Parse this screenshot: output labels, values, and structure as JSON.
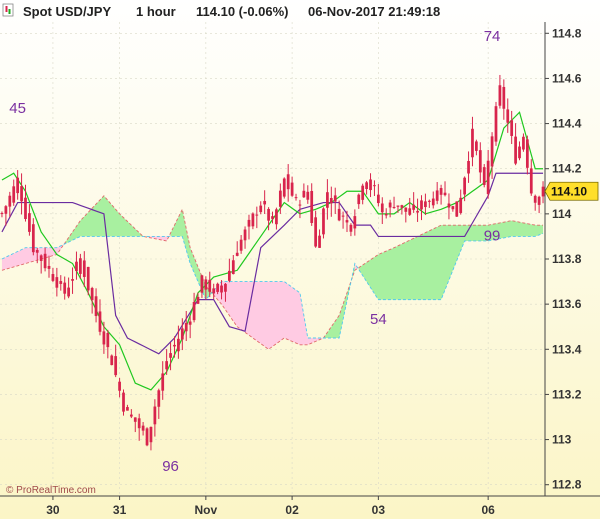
{
  "header": {
    "instrument": "Spot USD/JPY",
    "timeframe": "1 hour",
    "price_change": "114.10 (-0.06%)",
    "datetime": "06-Nov-2017 21:49:18"
  },
  "watermark": "© ProRealTime.com",
  "colors": {
    "bg_top": "#ffffff",
    "bg_bottom": "#fbf5c6",
    "up_candle": "#d8244c",
    "down_candle": "#d8244c",
    "kijun": "#6a2ca0",
    "tenkan": "#1fc81f",
    "cloud_bull": "#a8f0a0",
    "cloud_bear": "#ffcbe3",
    "span_b_line": "#4fc8ee",
    "span_a_line": "#e06a6a",
    "last_price_bg": "#ffdf2a"
  },
  "chart_data": {
    "type": "candlestick",
    "title": "Spot USD/JPY 1 hour",
    "ylim": [
      112.75,
      114.85
    ],
    "y_ticks": [
      "112.8",
      "113",
      "113.2",
      "113.4",
      "113.6",
      "113.8",
      "114",
      "114.2",
      "114.4",
      "114.6",
      "114.8"
    ],
    "y_tick_values": [
      112.8,
      113.0,
      113.2,
      113.4,
      113.6,
      113.8,
      114.0,
      114.2,
      114.4,
      114.6,
      114.8
    ],
    "x_ticks": [
      "30",
      "31",
      "Nov",
      "02",
      "03",
      "06"
    ],
    "x_tick_index": [
      13,
      30,
      52,
      74,
      96,
      124
    ],
    "n_bars": 139,
    "close_path": [
      [
        0,
        114.0
      ],
      [
        4,
        114.15
      ],
      [
        8,
        113.85
      ],
      [
        12,
        113.75
      ],
      [
        16,
        113.65
      ],
      [
        20,
        113.8
      ],
      [
        24,
        113.55
      ],
      [
        28,
        113.35
      ],
      [
        31,
        113.15
      ],
      [
        34,
        113.08
      ],
      [
        37,
        113.0
      ],
      [
        39,
        113.15
      ],
      [
        42,
        113.35
      ],
      [
        45,
        113.45
      ],
      [
        48,
        113.55
      ],
      [
        51,
        113.7
      ],
      [
        54,
        113.65
      ],
      [
        57,
        113.7
      ],
      [
        60,
        113.85
      ],
      [
        63,
        113.95
      ],
      [
        66,
        114.05
      ],
      [
        69,
        113.95
      ],
      [
        72,
        114.15
      ],
      [
        75,
        114.05
      ],
      [
        78,
        114.1
      ],
      [
        80,
        113.85
      ],
      [
        83,
        114.1
      ],
      [
        86,
        114.0
      ],
      [
        89,
        113.95
      ],
      [
        92,
        114.15
      ],
      [
        95,
        114.1
      ],
      [
        97,
        114.0
      ],
      [
        100,
        114.05
      ],
      [
        104,
        114.0
      ],
      [
        108,
        114.05
      ],
      [
        112,
        114.1
      ],
      [
        116,
        114.0
      ],
      [
        120,
        114.35
      ],
      [
        123,
        114.1
      ],
      [
        125,
        114.35
      ],
      [
        127,
        114.55
      ],
      [
        129,
        114.4
      ],
      [
        131,
        114.25
      ],
      [
        133,
        114.35
      ],
      [
        135,
        114.1
      ],
      [
        137,
        114.05
      ],
      [
        138,
        114.1
      ]
    ],
    "kijun_path": [
      [
        0,
        113.92
      ],
      [
        4,
        114.05
      ],
      [
        10,
        114.05
      ],
      [
        18,
        114.05
      ],
      [
        26,
        114.0
      ],
      [
        29,
        113.55
      ],
      [
        32,
        113.45
      ],
      [
        40,
        113.38
      ],
      [
        44,
        113.45
      ],
      [
        50,
        113.62
      ],
      [
        54,
        113.62
      ],
      [
        58,
        113.5
      ],
      [
        62,
        113.48
      ],
      [
        66,
        113.85
      ],
      [
        72,
        113.95
      ],
      [
        76,
        114.02
      ],
      [
        82,
        114.05
      ],
      [
        86,
        114.05
      ],
      [
        90,
        113.95
      ],
      [
        94,
        113.95
      ],
      [
        96,
        113.9
      ],
      [
        110,
        113.9
      ],
      [
        118,
        113.9
      ],
      [
        124,
        114.08
      ],
      [
        126,
        114.18
      ],
      [
        132,
        114.18
      ],
      [
        139,
        114.18
      ]
    ],
    "tenkan_path": [
      [
        0,
        114.15
      ],
      [
        3,
        114.18
      ],
      [
        6,
        114.1
      ],
      [
        10,
        113.92
      ],
      [
        14,
        113.82
      ],
      [
        18,
        113.78
      ],
      [
        22,
        113.65
      ],
      [
        26,
        113.5
      ],
      [
        30,
        113.42
      ],
      [
        34,
        113.25
      ],
      [
        38,
        113.22
      ],
      [
        42,
        113.3
      ],
      [
        46,
        113.45
      ],
      [
        50,
        113.65
      ],
      [
        54,
        113.72
      ],
      [
        60,
        113.75
      ],
      [
        64,
        113.85
      ],
      [
        68,
        113.95
      ],
      [
        72,
        114.05
      ],
      [
        76,
        114.0
      ],
      [
        80,
        114.02
      ],
      [
        84,
        114.05
      ],
      [
        88,
        114.1
      ],
      [
        92,
        114.1
      ],
      [
        96,
        114.0
      ],
      [
        100,
        114.0
      ],
      [
        104,
        114.05
      ],
      [
        108,
        114.0
      ],
      [
        112,
        114.02
      ],
      [
        116,
        114.05
      ],
      [
        120,
        114.1
      ],
      [
        124,
        114.15
      ],
      [
        128,
        114.38
      ],
      [
        132,
        114.45
      ],
      [
        136,
        114.2
      ],
      [
        139,
        114.2
      ]
    ],
    "cloud_span_a": [
      [
        0,
        113.75
      ],
      [
        6,
        113.78
      ],
      [
        14,
        113.82
      ],
      [
        20,
        113.97
      ],
      [
        26,
        114.08
      ],
      [
        30,
        114.0
      ],
      [
        36,
        113.9
      ],
      [
        42,
        113.88
      ],
      [
        46,
        114.02
      ],
      [
        48,
        113.85
      ],
      [
        52,
        113.68
      ],
      [
        56,
        113.6
      ],
      [
        60,
        113.5
      ],
      [
        64,
        113.45
      ],
      [
        68,
        113.4
      ],
      [
        72,
        113.45
      ],
      [
        76,
        113.42
      ],
      [
        78,
        113.42
      ],
      [
        82,
        113.45
      ],
      [
        86,
        113.55
      ],
      [
        90,
        113.75
      ],
      [
        96,
        113.82
      ],
      [
        100,
        113.85
      ],
      [
        106,
        113.9
      ],
      [
        112,
        113.95
      ],
      [
        118,
        113.95
      ],
      [
        124,
        113.95
      ],
      [
        130,
        113.97
      ],
      [
        136,
        113.95
      ],
      [
        139,
        113.95
      ]
    ],
    "cloud_span_b": [
      [
        0,
        113.8
      ],
      [
        6,
        113.85
      ],
      [
        14,
        113.85
      ],
      [
        20,
        113.9
      ],
      [
        26,
        113.9
      ],
      [
        30,
        113.9
      ],
      [
        36,
        113.9
      ],
      [
        42,
        113.9
      ],
      [
        46,
        113.9
      ],
      [
        48,
        113.78
      ],
      [
        52,
        113.62
      ],
      [
        56,
        113.7
      ],
      [
        60,
        113.7
      ],
      [
        64,
        113.7
      ],
      [
        68,
        113.7
      ],
      [
        72,
        113.7
      ],
      [
        76,
        113.65
      ],
      [
        78,
        113.45
      ],
      [
        82,
        113.45
      ],
      [
        86,
        113.45
      ],
      [
        90,
        113.78
      ],
      [
        96,
        113.62
      ],
      [
        100,
        113.62
      ],
      [
        106,
        113.62
      ],
      [
        112,
        113.62
      ],
      [
        118,
        113.88
      ],
      [
        124,
        113.88
      ],
      [
        130,
        113.9
      ],
      [
        136,
        113.9
      ],
      [
        139,
        113.92
      ]
    ],
    "annotations": [
      {
        "label": "45",
        "bar": 4,
        "value": 114.42,
        "placement": "above"
      },
      {
        "label": "96",
        "bar": 43,
        "value": 112.95,
        "placement": "below"
      },
      {
        "label": "54",
        "bar": 96,
        "value": 113.6,
        "placement": "below"
      },
      {
        "label": "74",
        "bar": 125,
        "value": 114.74,
        "placement": "above"
      },
      {
        "label": "99",
        "bar": 125,
        "value": 113.9,
        "placement": "right"
      }
    ],
    "last_price": 114.1,
    "last_price_label": "114.10"
  }
}
